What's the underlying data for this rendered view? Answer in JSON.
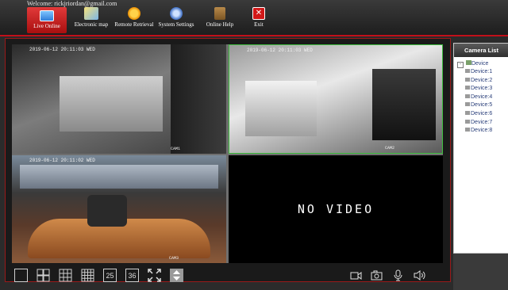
{
  "header": {
    "welcome": "Welcome: rickjriordan@gmail.com"
  },
  "nav": [
    {
      "label": "Live Online",
      "icon": "live-online-icon"
    },
    {
      "label": "Electronic map",
      "icon": "electronic-map-icon"
    },
    {
      "label": "Remote Retrieval",
      "icon": "remote-retrieval-icon"
    },
    {
      "label": "System Settings",
      "icon": "system-settings-icon"
    },
    {
      "label": "Online Help",
      "icon": "online-help-icon"
    },
    {
      "label": "Exit",
      "icon": "exit-icon"
    }
  ],
  "cameras": [
    {
      "timestamp": "2019-06-12 20:11:03 WED",
      "name": "CAM1"
    },
    {
      "timestamp": "2019-06-12 20:11:03 WED",
      "name": "CAM2"
    },
    {
      "timestamp": "2019-06-12 20:11:02 WED",
      "name": "CAM3"
    },
    {
      "no_video": "NO VIDEO"
    }
  ],
  "camera_list": {
    "title": "Camera List",
    "root": "Device",
    "items": [
      "Device:1",
      "Device:2",
      "Device:3",
      "Device:4",
      "Device:5",
      "Device:6",
      "Device:7",
      "Device:8"
    ]
  },
  "toolbar": {
    "layout_25": "25",
    "layout_36": "36"
  },
  "colors": {
    "accent": "#c2101a",
    "active_tab": "#d42020",
    "tree_text": "#2a3f7a"
  }
}
